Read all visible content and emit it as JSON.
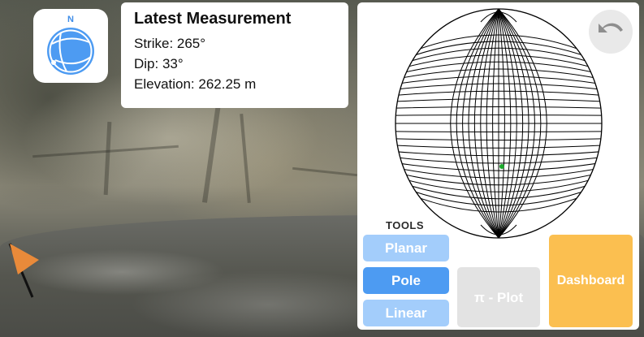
{
  "compass": {
    "north_label": "N",
    "icon": "compass-icon"
  },
  "measurement": {
    "title": "Latest Measurement",
    "strike": "Strike: 265°",
    "dip": "Dip: 33°",
    "elevation": "Elevation: 262.25 m"
  },
  "stereonet": {
    "icon": "stereonet-icon",
    "marker_color": "#1aa82a"
  },
  "undo": {
    "icon": "undo-icon"
  },
  "tools": {
    "label": "TOOLS",
    "planar": "Planar",
    "pole": "Pole",
    "linear": "Linear",
    "selected": "Pole"
  },
  "buttons": {
    "pi_plot": "π - Plot",
    "dashboard": "Dashboard"
  },
  "colors": {
    "tool_light": "#a3cdfb",
    "tool_active": "#4d9bf2",
    "dashboard": "#fbbf50",
    "pi_plot_disabled": "#e3e3e3",
    "compass_blue": "#4d9bf2",
    "flag_orange": "#e98a3a"
  }
}
